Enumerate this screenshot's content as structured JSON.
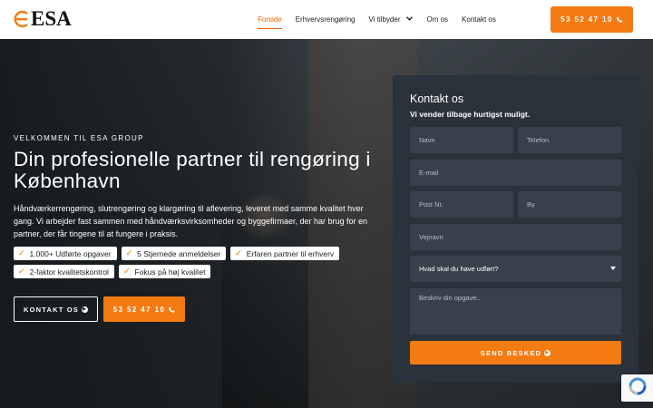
{
  "brand": {
    "name": "ESA"
  },
  "nav": {
    "items": [
      {
        "label": "Forside",
        "active": true
      },
      {
        "label": "Erhvervsrengøring",
        "active": false
      },
      {
        "label": "Vi tilbyder",
        "active": false,
        "has_dropdown": true
      },
      {
        "label": "Om os",
        "active": false
      },
      {
        "label": "Kontakt os",
        "active": false
      }
    ],
    "phone_label": "53 52 47 10"
  },
  "hero": {
    "eyebrow": "VELKOMMEN TIL ESA GROUP",
    "title": "Din profesionelle partner til rengøring i København",
    "description": "Håndværkerrengøring, slutrengøring og klargøring til aflevering, leveret med samme kvalitet hver gang. Vi arbejder fast sammen med håndværksvirksomheder og byggefirmaer, der har brug for en partner, der får tingene til at fungere i praksis.",
    "badges": [
      "1.000+ Udførte opgaver",
      "5 Stjernede anmeldelser",
      "Erfaren partner til erhverv",
      "2-faktor kvalitetskontrol",
      "Fokus på høj kvalitet"
    ],
    "cta_contact": "KONTAKT OS",
    "cta_phone": "53 52 47 10"
  },
  "contact_form": {
    "title": "Kontakt os",
    "subtitle": "Vi vender tilbage hurtigst muligt.",
    "placeholders": {
      "name": "Navn",
      "phone": "Telefon",
      "email": "E-mail",
      "zip": "Post Nr.",
      "city": "By",
      "street": "Vejnavn",
      "task_select": "Hvad skal du have udført?",
      "description": "Beskriv din opgave.."
    },
    "submit_label": "SEND BESKED"
  },
  "colors": {
    "accent": "#f47a12",
    "card_bg": "#2a323b",
    "field_bg": "#38414b"
  }
}
